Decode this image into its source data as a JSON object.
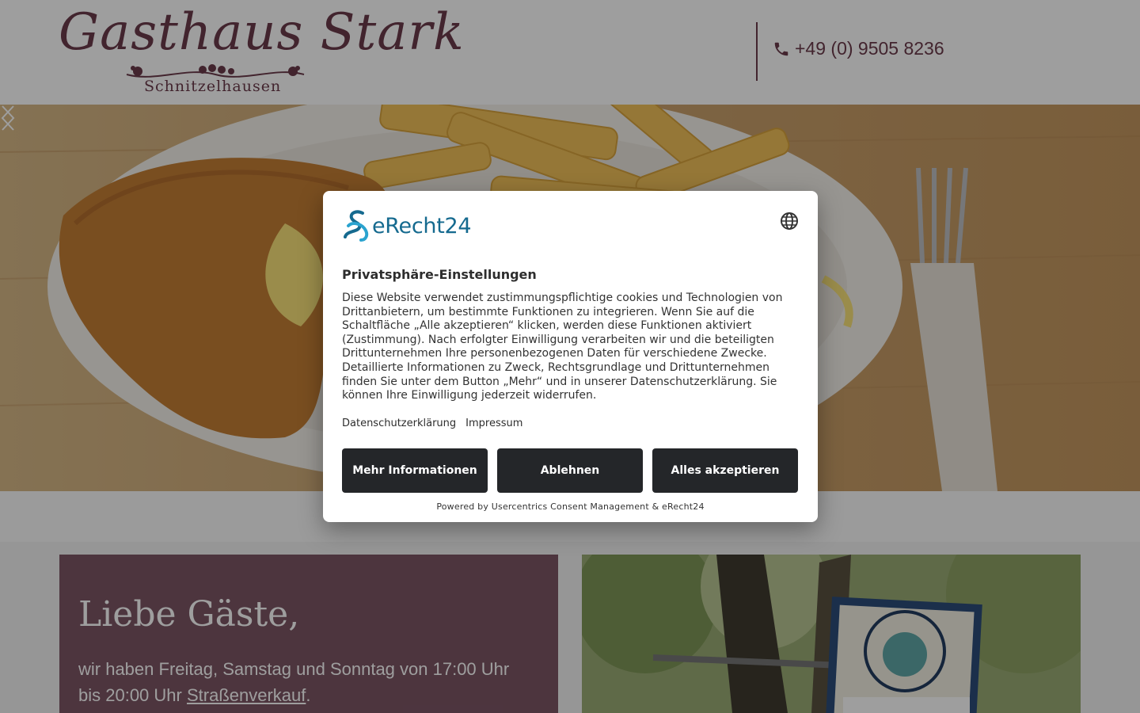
{
  "header": {
    "logo_title": "Gasthaus Stark",
    "logo_subtitle": "Schnitzelhausen",
    "phone": "+49 (0) 9505 8236"
  },
  "hero": {
    "image": "schnitzel-with-fries-plate",
    "prev_icon": "chevron-left-icon",
    "next_icon": "chevron-right-icon"
  },
  "welcome": {
    "title": "Liebe Gäste,",
    "text_before": "wir haben Freitag, Samstag und Sonntag von 17:00 Uhr bis 20:00 Uhr ",
    "link": "Straßenverkauf",
    "text_after": "."
  },
  "photo": {
    "image": "tree-with-gasthaus-sign"
  },
  "consent": {
    "brand": "eRecht24",
    "title": "Privatsphäre-Einstellungen",
    "body": "Diese Website verwendet zustimmungspflichtige cookies und Technologien von Drittanbietern, um bestimmte Funktionen zu integrieren. Wenn Sie auf die Schaltfläche „Alle akzeptieren“ klicken, werden diese Funktionen aktiviert (Zustimmung). Nach erfolgter Einwilligung verarbeiten wir und die beteiligten Drittunternehmen Ihre personenbezogenen Daten für verschiedene Zwecke. Detaillierte Informationen zu Zweck, Rechtsgrundlage und Drittunternehmen finden Sie unter dem Button „Mehr“ und in unserer Datenschutzerklärung. Sie können Ihre Einwilligung jederzeit widerrufen.",
    "links": [
      "Datenschutzerklärung",
      "Impressum"
    ],
    "buttons": {
      "more": "Mehr Informationen",
      "deny": "Ablehnen",
      "accept": "Alles akzeptieren"
    },
    "powered_by": "Powered by Usercentrics Consent Management & eRecht24"
  },
  "colors": {
    "brand": "#6b3a4b",
    "welcome_bg": "#7d5665",
    "button_bg": "#242629",
    "erecht_blue": "#156a8f"
  }
}
